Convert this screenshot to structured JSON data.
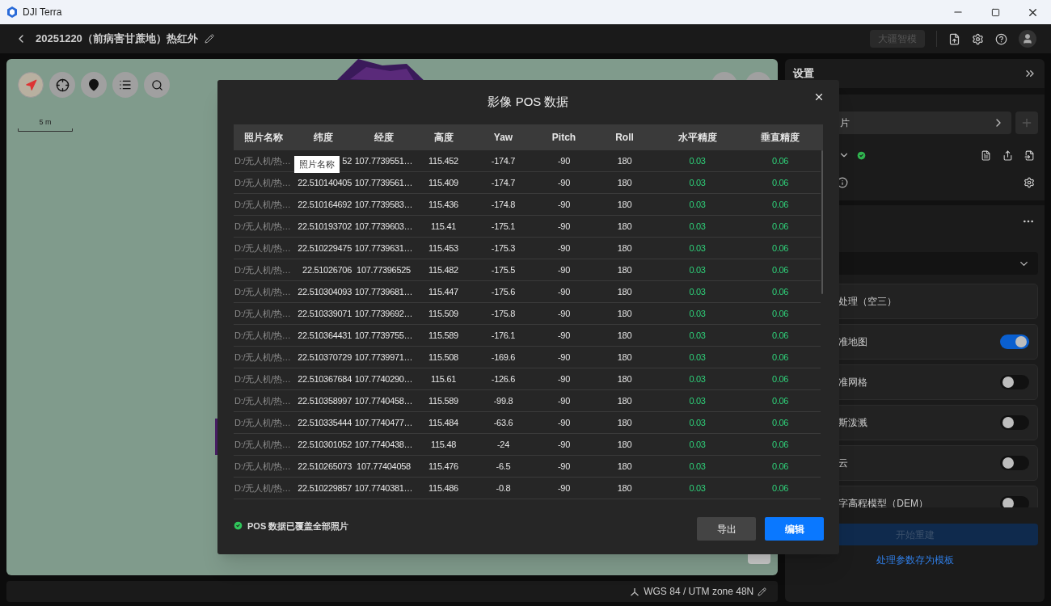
{
  "window": {
    "title": "DJI Terra"
  },
  "header": {
    "project_title": "20251220（前病害甘蔗地）热红外",
    "model_button": {
      "label": "大疆智模",
      "disabled": true
    }
  },
  "map": {
    "scale_label": "5 m"
  },
  "status_bar": {
    "coordinate_system": "WGS 84 / UTM zone 48N"
  },
  "settings_panel": {
    "title": "设置",
    "source_field": "片",
    "cards": [
      {
        "kind": "plain",
        "label": "处理（空三）"
      },
      {
        "kind": "toggle",
        "label": "准地图",
        "on": true
      },
      {
        "kind": "toggle",
        "label": "准网格",
        "on": false
      },
      {
        "kind": "toggle",
        "label": "斯泼溅",
        "on": false
      },
      {
        "kind": "toggle",
        "label": "云",
        "on": false
      },
      {
        "kind": "toggle",
        "label": "字高程模型（DEM）",
        "on": false
      }
    ],
    "start_button": {
      "label": "开始重建",
      "disabled": true
    },
    "template_link": "处理参数存为模板"
  },
  "dialog": {
    "title": "影像 POS 数据",
    "tooltip": "照片名称",
    "columns": [
      {
        "label": "照片名称",
        "kind": "name"
      },
      {
        "label": "纬度",
        "kind": "lat"
      },
      {
        "label": "经度",
        "kind": "text"
      },
      {
        "label": "高度",
        "kind": "text"
      },
      {
        "label": "Yaw",
        "kind": "text"
      },
      {
        "label": "Pitch",
        "kind": "text"
      },
      {
        "label": "Roll",
        "kind": "text"
      },
      {
        "label": "水平精度",
        "kind": "accuracy"
      },
      {
        "label": "垂直精度",
        "kind": "accuracy"
      }
    ],
    "rows": [
      [
        "D:/无人机/热…",
        "52",
        "107.7739551…",
        "115.452",
        "-174.7",
        "-90",
        "180",
        "0.03",
        "0.06"
      ],
      [
        "D:/无人机/热…",
        "22.510140405",
        "107.7739561…",
        "115.409",
        "-174.7",
        "-90",
        "180",
        "0.03",
        "0.06"
      ],
      [
        "D:/无人机/热…",
        "22.510164692",
        "107.7739583…",
        "115.436",
        "-174.8",
        "-90",
        "180",
        "0.03",
        "0.06"
      ],
      [
        "D:/无人机/热…",
        "22.510193702",
        "107.7739603…",
        "115.41",
        "-175.1",
        "-90",
        "180",
        "0.03",
        "0.06"
      ],
      [
        "D:/无人机/热…",
        "22.510229475",
        "107.7739631…",
        "115.453",
        "-175.3",
        "-90",
        "180",
        "0.03",
        "0.06"
      ],
      [
        "D:/无人机/热…",
        "22.51026706",
        "107.77396525",
        "115.482",
        "-175.5",
        "-90",
        "180",
        "0.03",
        "0.06"
      ],
      [
        "D:/无人机/热…",
        "22.510304093",
        "107.7739681…",
        "115.447",
        "-175.6",
        "-90",
        "180",
        "0.03",
        "0.06"
      ],
      [
        "D:/无人机/热…",
        "22.510339071",
        "107.7739692…",
        "115.509",
        "-175.8",
        "-90",
        "180",
        "0.03",
        "0.06"
      ],
      [
        "D:/无人机/热…",
        "22.510364431",
        "107.7739755…",
        "115.589",
        "-176.1",
        "-90",
        "180",
        "0.03",
        "0.06"
      ],
      [
        "D:/无人机/热…",
        "22.510370729",
        "107.7739971…",
        "115.508",
        "-169.6",
        "-90",
        "180",
        "0.03",
        "0.06"
      ],
      [
        "D:/无人机/热…",
        "22.510367684",
        "107.7740290…",
        "115.61",
        "-126.6",
        "-90",
        "180",
        "0.03",
        "0.06"
      ],
      [
        "D:/无人机/热…",
        "22.510358997",
        "107.7740458…",
        "115.589",
        "-99.8",
        "-90",
        "180",
        "0.03",
        "0.06"
      ],
      [
        "D:/无人机/热…",
        "22.510335444",
        "107.7740477…",
        "115.484",
        "-63.6",
        "-90",
        "180",
        "0.03",
        "0.06"
      ],
      [
        "D:/无人机/热…",
        "22.510301052",
        "107.7740438…",
        "115.48",
        "-24",
        "-90",
        "180",
        "0.03",
        "0.06"
      ],
      [
        "D:/无人机/热…",
        "22.510265073",
        "107.77404058",
        "115.476",
        "-6.5",
        "-90",
        "180",
        "0.03",
        "0.06"
      ],
      [
        "D:/无人机/热…",
        "22.510229857",
        "107.7740381…",
        "115.486",
        "-0.8",
        "-90",
        "180",
        "0.03",
        "0.06"
      ]
    ],
    "status": "POS 数据已覆盖全部照片",
    "buttons": [
      {
        "label": "导出",
        "kind": "secondary"
      },
      {
        "label": "编辑",
        "kind": "primary"
      }
    ]
  }
}
